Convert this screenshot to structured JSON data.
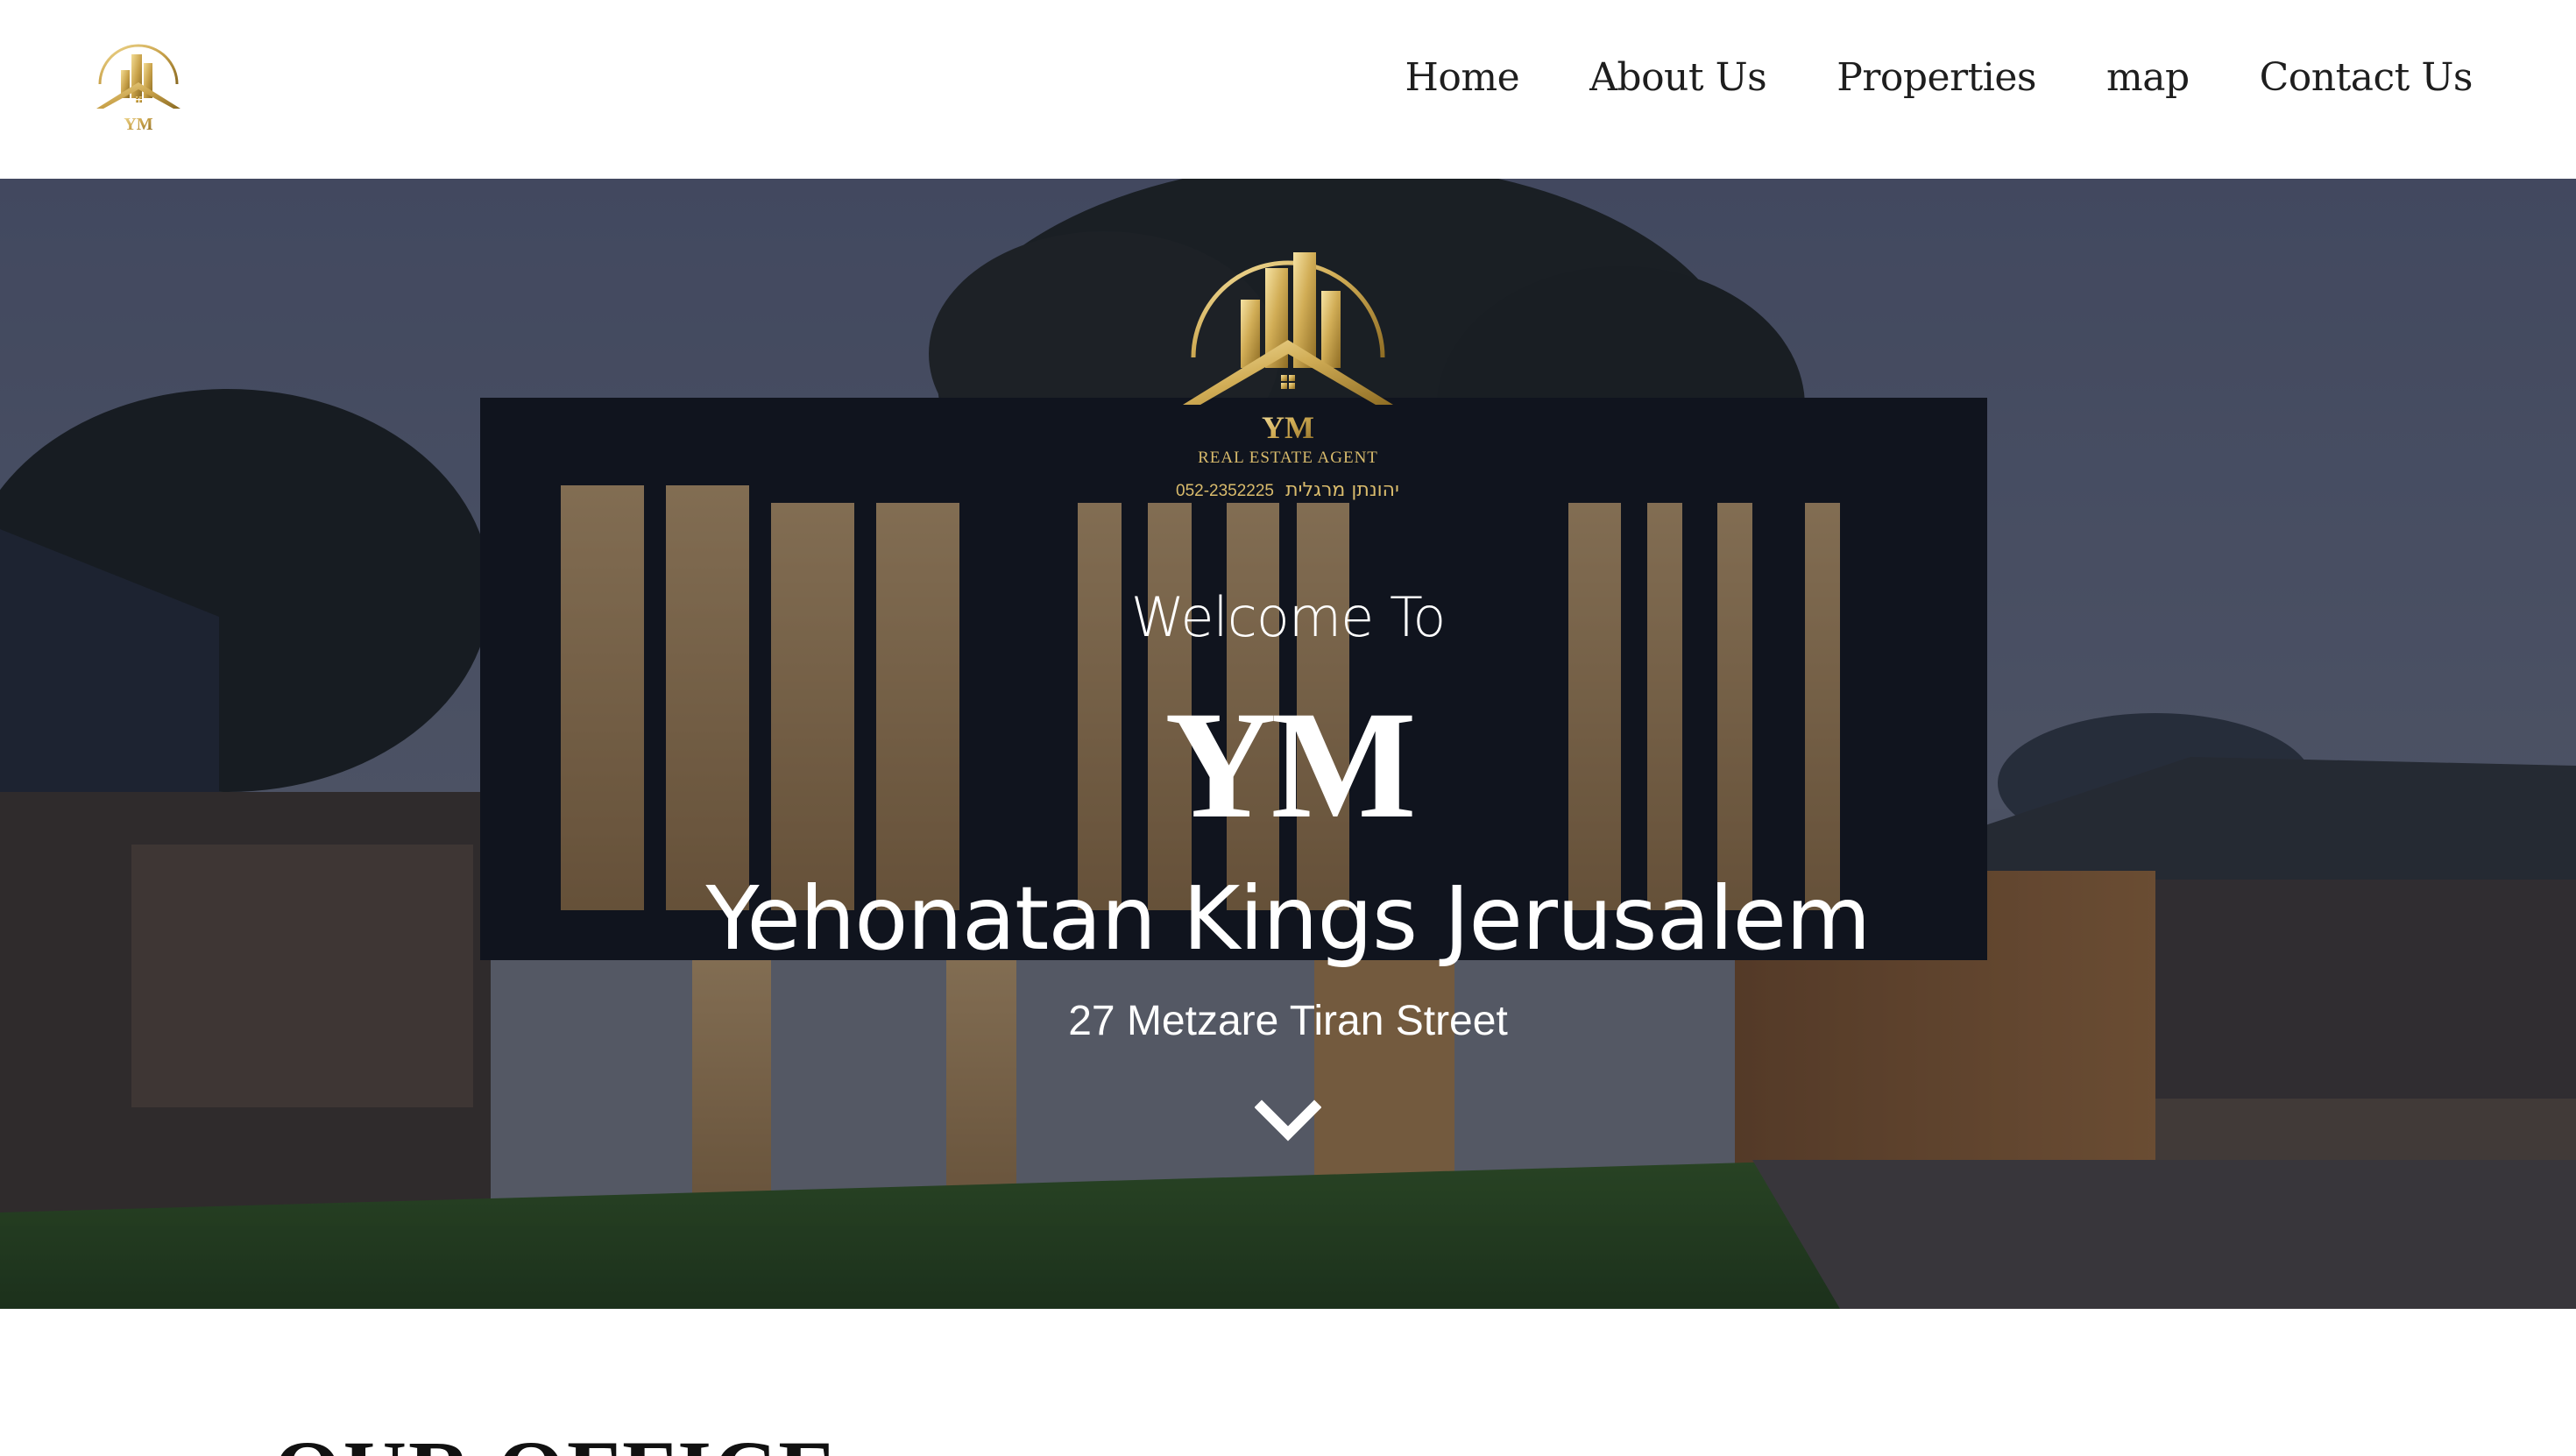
{
  "header": {
    "logo_text": "YM",
    "nav": [
      {
        "label": "Home"
      },
      {
        "label": "About Us"
      },
      {
        "label": "Properties"
      },
      {
        "label": "map"
      },
      {
        "label": "Contact Us"
      }
    ]
  },
  "hero": {
    "logo": {
      "monogram": "YM",
      "tagline": "REAL ESTATE AGENT",
      "phone": "052-2352225",
      "hebrew_name": "יהונתן מרגלית"
    },
    "welcome": "Welcome To",
    "brand": "YM",
    "agent_name": "Yehonatan Kings Jerusalem",
    "address": "27 Metzare Tiran Street"
  },
  "section": {
    "heading": "OUR OFFICE"
  },
  "colors": {
    "gold": "#c9a24a",
    "gold_light": "#f0d68a",
    "nav_text": "#1e1e1e",
    "hero_text": "#ffffff"
  },
  "icons": {
    "logo": "building-house-logo-icon",
    "scroll": "chevron-down-icon"
  }
}
